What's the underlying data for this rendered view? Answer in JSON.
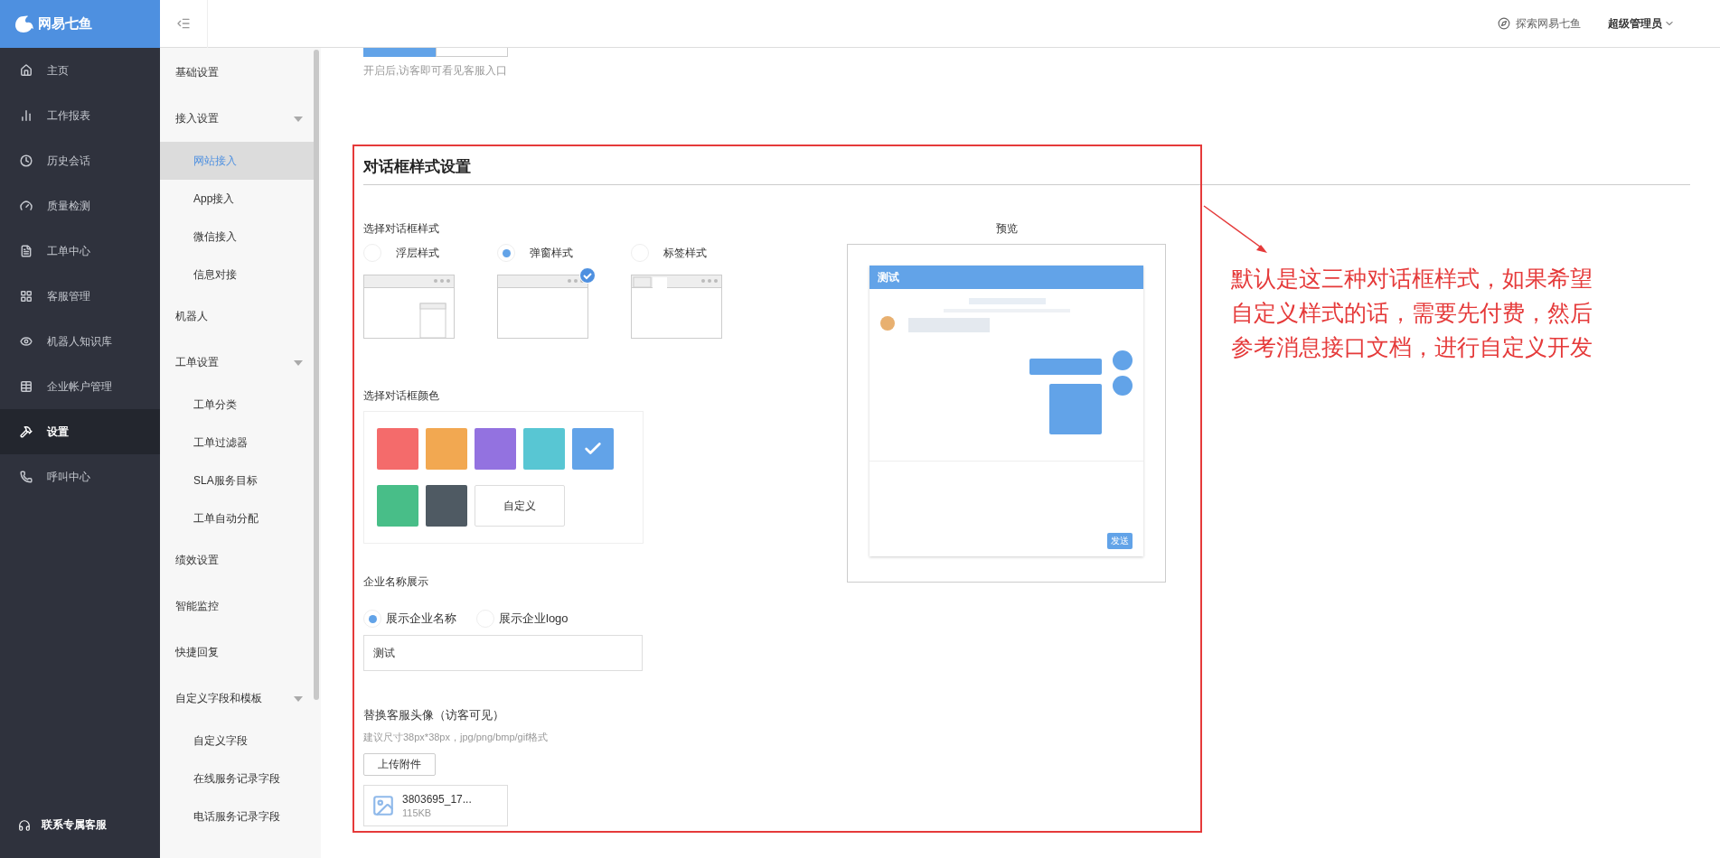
{
  "brand": {
    "name": "网易七鱼"
  },
  "nav": {
    "items": [
      {
        "label": "主页",
        "selected": false
      },
      {
        "label": "工作报表",
        "selected": false
      },
      {
        "label": "历史会话",
        "selected": false
      },
      {
        "label": "质量检测",
        "selected": false
      },
      {
        "label": "工单中心",
        "selected": false
      },
      {
        "label": "客服管理",
        "selected": false
      },
      {
        "label": "机器人知识库",
        "selected": false
      },
      {
        "label": "企业帐户管理",
        "selected": false
      },
      {
        "label": "设置",
        "selected": true
      },
      {
        "label": "呼叫中心",
        "selected": false
      }
    ],
    "footer": "联系专属客服"
  },
  "topbar": {
    "explore": "探索网易七鱼",
    "user": "超级管理员"
  },
  "settings_menu": {
    "items": [
      {
        "label": "基础设置",
        "selected": false
      },
      {
        "label": "接入设置",
        "expanded": true,
        "children": [
          {
            "label": "网站接入",
            "selected": true
          },
          {
            "label": "App接入",
            "selected": false
          },
          {
            "label": "微信接入",
            "selected": false
          },
          {
            "label": "信息对接",
            "selected": false
          }
        ]
      },
      {
        "label": "机器人",
        "selected": false
      },
      {
        "label": "工单设置",
        "expanded": true,
        "children": [
          {
            "label": "工单分类",
            "selected": false
          },
          {
            "label": "工单过滤器",
            "selected": false
          },
          {
            "label": "SLA服务目标",
            "selected": false
          },
          {
            "label": "工单自动分配",
            "selected": false
          }
        ]
      },
      {
        "label": "绩效设置",
        "selected": false
      },
      {
        "label": "智能监控",
        "selected": false
      },
      {
        "label": "快捷回复",
        "selected": false
      },
      {
        "label": "自定义字段和模板",
        "expanded": true,
        "children": [
          {
            "label": "自定义字段",
            "selected": false
          },
          {
            "label": "在线服务记录字段",
            "selected": false
          },
          {
            "label": "电话服务记录字段",
            "selected": false
          }
        ]
      }
    ]
  },
  "entry_toggle": {
    "segments": [
      {
        "selected": true
      },
      {
        "selected": false
      }
    ],
    "hint": "开启后,访客即可看见客服入口"
  },
  "dialog_style": {
    "title": "对话框样式设置",
    "style_label": "选择对话框样式",
    "styles": [
      {
        "label": "浮层样式",
        "kind": "float",
        "selected": false
      },
      {
        "label": "弹窗样式",
        "kind": "popup",
        "selected": true
      },
      {
        "label": "标签样式",
        "kind": "tab",
        "selected": false
      }
    ],
    "color_label": "选择对话框颜色",
    "colors": [
      {
        "color": "#f46b6b",
        "selected": false
      },
      {
        "color": "#f2a851",
        "selected": false
      },
      {
        "color": "#9372e0",
        "selected": false
      },
      {
        "color": "#58c6d3",
        "selected": false
      },
      {
        "color": "#62a3e8",
        "selected": true
      },
      {
        "color": "#48be88",
        "selected": false
      },
      {
        "color": "#4f5a63",
        "selected": false
      }
    ],
    "custom_color": "自定义",
    "company_label": "企业名称展示",
    "company_options": [
      {
        "label": "展示企业名称",
        "selected": true
      },
      {
        "label": "展示企业logo",
        "selected": false
      }
    ],
    "company_name": "测试",
    "avatar_label": "替换客服头像（访客可见）",
    "avatar_hint": "建议尺寸38px*38px，jpg/png/bmp/gif格式",
    "upload_button": "上传附件",
    "file": {
      "name": "3803695_17...",
      "size": "115KB"
    },
    "preview": {
      "label": "预览",
      "title": "测试",
      "send": "发送"
    }
  },
  "annotation": {
    "lines": [
      "默认是这三种对话框样式，如果希望",
      "自定义样式的话，需要先付费，然后",
      "参考消息接口文档，进行自定义开发"
    ]
  }
}
